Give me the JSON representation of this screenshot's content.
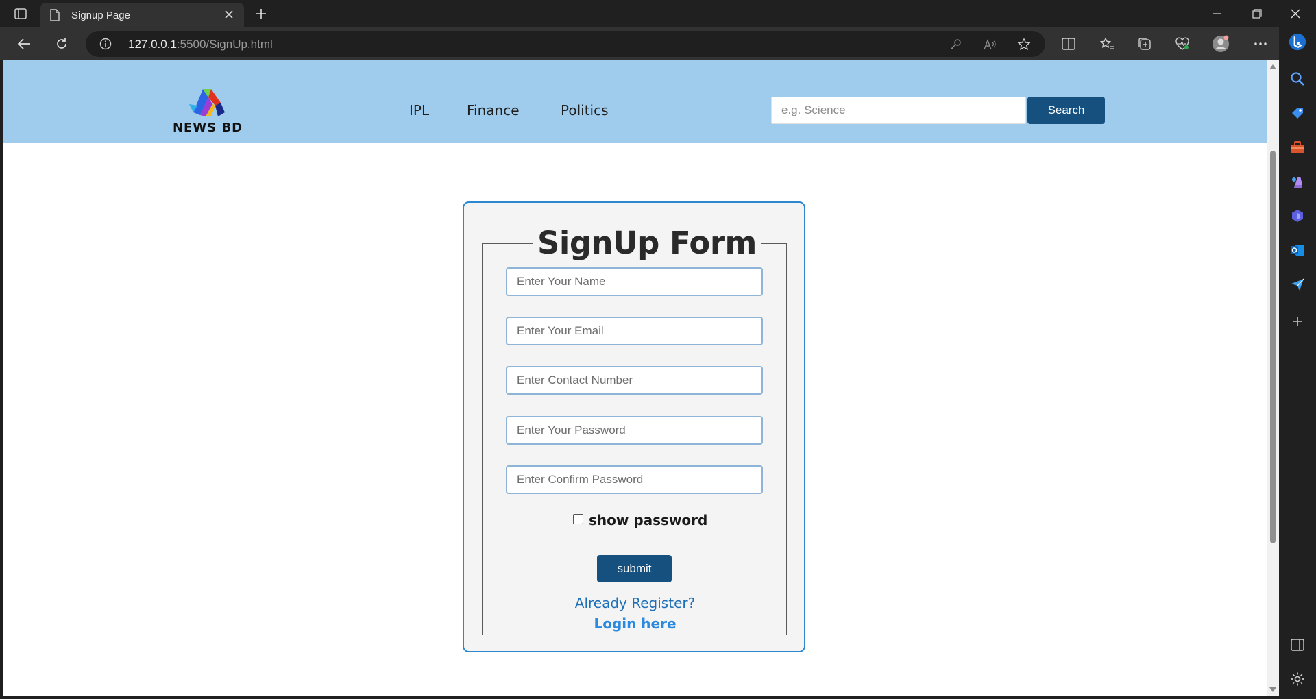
{
  "browser": {
    "tab_title": "Signup Page",
    "url_host": "127.0.0.1",
    "url_rest": ":5500/SignUp.html"
  },
  "site": {
    "logo_text": "NEWS BD",
    "nav": [
      "IPL",
      "Finance",
      "Politics"
    ],
    "search": {
      "placeholder": "e.g. Science",
      "button": "Search"
    }
  },
  "form": {
    "title": "SignUp Form",
    "fields": [
      {
        "placeholder": "Enter Your Name"
      },
      {
        "placeholder": "Enter Your Email"
      },
      {
        "placeholder": "Enter Contact Number"
      },
      {
        "placeholder": "Enter Your Password"
      },
      {
        "placeholder": "Enter Confirm Password"
      }
    ],
    "show_password_label": "show password",
    "submit_label": "submit",
    "already_text": "Already Register?",
    "login_text": "Login here"
  },
  "colors": {
    "header_bg": "#9fcbec",
    "primary_button": "#15507e",
    "card_border": "#2a87d0",
    "link": "#1d70b8"
  }
}
